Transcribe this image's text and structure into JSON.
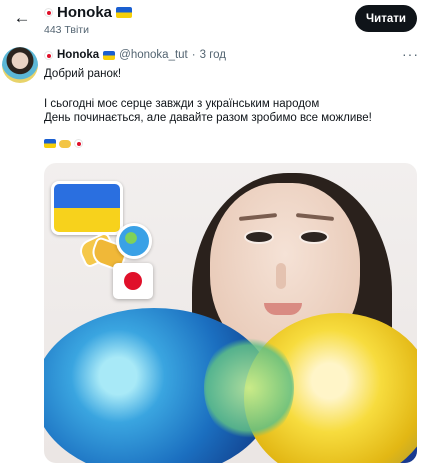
{
  "header": {
    "back_label": "←",
    "name": "Honoka",
    "tweet_count": "443 Твіти",
    "follow_label": "Читати"
  },
  "tweet": {
    "author_name": "Honoka",
    "handle": "@honoka_tut",
    "separator": "·",
    "time": "3 год",
    "more_label": "···",
    "lines": [
      "Добрий ранок!",
      "І сьогодні моє серце завжди з українським народом",
      "День починається, але давайте разом зробимо все можливе!"
    ]
  },
  "colors": {
    "accent": "#0f1419",
    "secondary_text": "#536471",
    "ua_blue": "#1a5fd0",
    "ua_yellow": "#f6cf08",
    "jp_red": "#e0102a"
  }
}
